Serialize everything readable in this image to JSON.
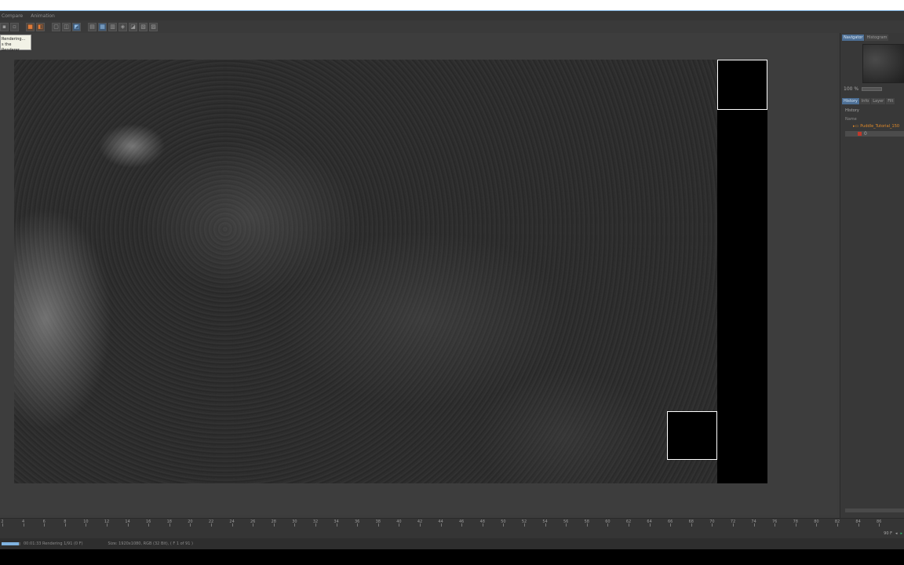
{
  "menu": [
    "Compare",
    "Animation"
  ],
  "tooltip": {
    "line1": "Rendering...",
    "line2": "s the Renderer"
  },
  "panel": {
    "tabs_top": [
      "Navigator",
      "Histogram"
    ],
    "zoom": "100 %",
    "tabs_mid": [
      "History",
      "Info",
      "Layer",
      "Filt"
    ],
    "history_label": "History",
    "col_name": "Name",
    "history_item": "Puddle_Tutorial_150",
    "history_sub": "0"
  },
  "timeline": {
    "ticks": [
      "2",
      "4",
      "6",
      "8",
      "10",
      "12",
      "14",
      "16",
      "18",
      "20",
      "22",
      "24",
      "26",
      "28",
      "30",
      "32",
      "34",
      "36",
      "38",
      "40",
      "42",
      "44",
      "46",
      "48",
      "50",
      "52",
      "54",
      "56",
      "58",
      "60",
      "62",
      "64",
      "66",
      "68",
      "70",
      "72",
      "74",
      "76",
      "78",
      "80",
      "82",
      "84",
      "86"
    ],
    "frame_field": "90 F"
  },
  "status": {
    "progress": 0.9,
    "time": "00:01:33 Rendering 1/91 (0 F)",
    "size": "Size: 1920x1080, RGB (32 Bit),  ( F 1 of 91 )"
  }
}
